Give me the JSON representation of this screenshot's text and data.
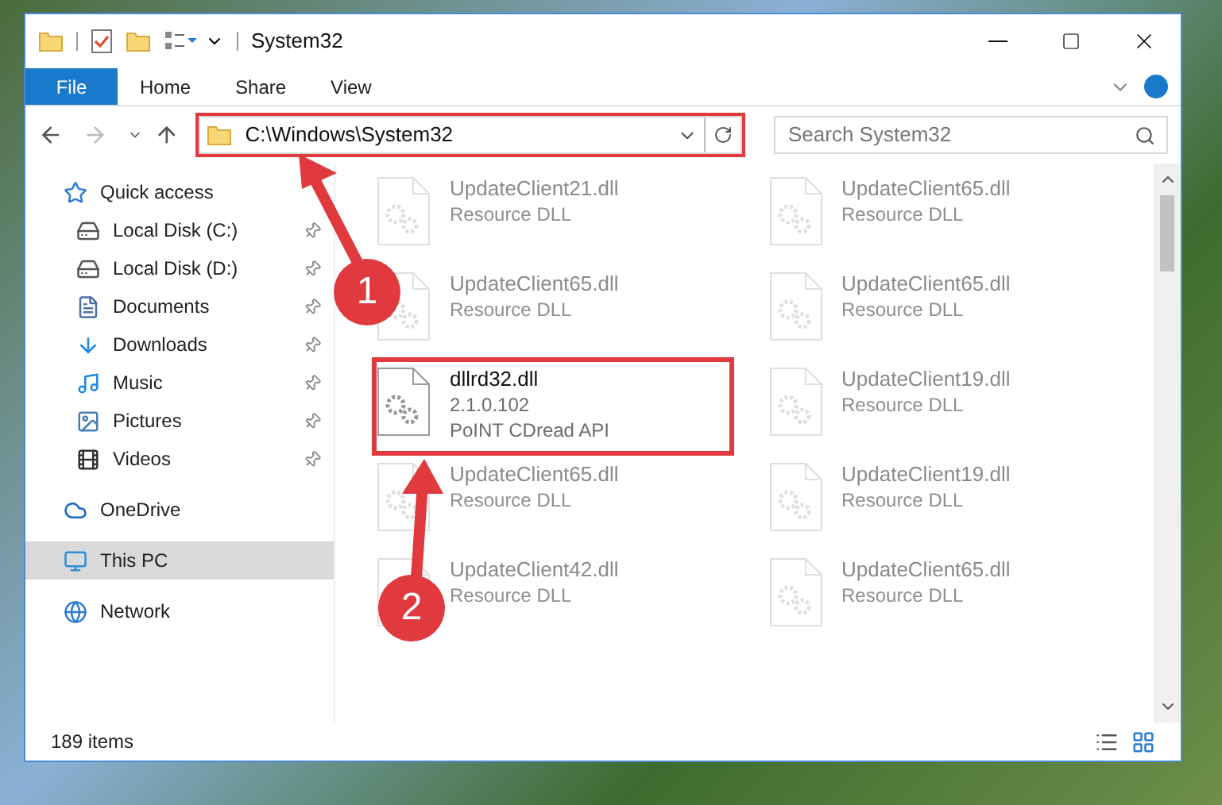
{
  "window": {
    "title": "System32"
  },
  "ribbon_tabs": [
    {
      "label": "File",
      "selected": true
    },
    {
      "label": "Home",
      "selected": false
    },
    {
      "label": "Share",
      "selected": false
    },
    {
      "label": "View",
      "selected": false
    }
  ],
  "address": {
    "path": "C:\\Windows\\System32"
  },
  "search": {
    "placeholder": "Search System32"
  },
  "sidebar": {
    "items": [
      {
        "label": "Quick access",
        "kind": "star",
        "pinned": false,
        "selected": false,
        "children": [
          {
            "label": "Local Disk (C:)",
            "kind": "disk",
            "pinned": true,
            "selected": false
          },
          {
            "label": "Local Disk (D:)",
            "kind": "disk",
            "pinned": true,
            "selected": false
          },
          {
            "label": "Documents",
            "kind": "doc",
            "pinned": true,
            "selected": false
          },
          {
            "label": "Downloads",
            "kind": "download",
            "pinned": true,
            "selected": false
          },
          {
            "label": "Music",
            "kind": "music",
            "pinned": true,
            "selected": false
          },
          {
            "label": "Pictures",
            "kind": "picture",
            "pinned": true,
            "selected": false
          },
          {
            "label": "Videos",
            "kind": "video",
            "pinned": true,
            "selected": false
          }
        ]
      },
      {
        "label": "OneDrive",
        "kind": "cloud",
        "pinned": false,
        "selected": false
      },
      {
        "label": "This PC",
        "kind": "pc",
        "pinned": false,
        "selected": true
      },
      {
        "label": "Network",
        "kind": "network",
        "pinned": false,
        "selected": false
      }
    ]
  },
  "files": [
    {
      "name": "UpdateClient21.dll",
      "lines": [
        "Resource DLL"
      ],
      "faded": true
    },
    {
      "name": "UpdateClient65.dll",
      "lines": [
        "Resource DLL"
      ],
      "faded": true
    },
    {
      "name": "UpdateClient65.dll",
      "lines": [
        "Resource DLL"
      ],
      "faded": true
    },
    {
      "name": "UpdateClient65.dll",
      "lines": [
        "Resource DLL"
      ],
      "faded": true
    },
    {
      "name": "dllrd32.dll",
      "lines": [
        "2.1.0.102",
        "PoINT CDread API"
      ],
      "faded": false
    },
    {
      "name": "UpdateClient19.dll",
      "lines": [
        "Resource DLL"
      ],
      "faded": true
    },
    {
      "name": "UpdateClient65.dll",
      "lines": [
        "Resource DLL"
      ],
      "faded": true
    },
    {
      "name": "UpdateClient19.dll",
      "lines": [
        "Resource DLL"
      ],
      "faded": true
    },
    {
      "name": "UpdateClient42.dll",
      "lines": [
        "Resource DLL"
      ],
      "faded": true
    },
    {
      "name": "UpdateClient65.dll",
      "lines": [
        "Resource DLL"
      ],
      "faded": true
    }
  ],
  "status_bar": {
    "count": "189 items"
  },
  "annotations": [
    {
      "number": "1"
    },
    {
      "number": "2"
    }
  ]
}
